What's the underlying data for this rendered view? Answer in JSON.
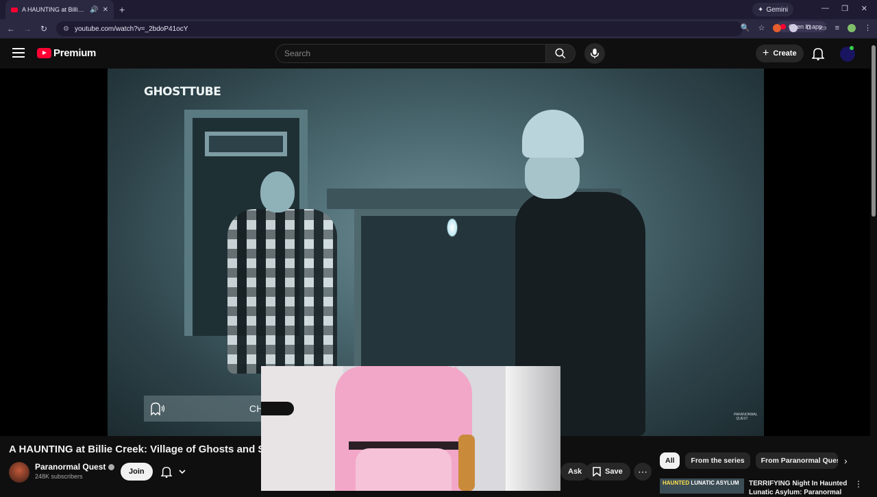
{
  "browser": {
    "tab_title": "A HAUNTING at Billie Creek",
    "url": "youtube.com/watch?v=_2bdoP41ocY",
    "gemini_label": "Gemini",
    "open_in_app_label": "Open in app"
  },
  "header": {
    "brand": "Premium",
    "search_placeholder": "Search",
    "create_label": "Create"
  },
  "player": {
    "overlay_logo": "GHOSTTUBE",
    "nametag": "CHRISTIAN",
    "watermark": "PARANORMAL QUEST"
  },
  "video": {
    "title": "A HAUNTING at Billie Creek: Village of Ghosts and Spirit",
    "channel_name": "Paranormal Quest",
    "subscribers": "248K subscribers",
    "join_label": "Join",
    "ask_label": "Ask",
    "save_label": "Save"
  },
  "chips": [
    "All",
    "From the series",
    "From Paranormal Quest"
  ],
  "recommended": {
    "thumb_text_1": "HAUNTED",
    "thumb_text_2": "LUNATIC ASYLUM",
    "title": "TERRIFYING Night In Haunted Lunatic Asylum: Paranormal"
  },
  "colors": {
    "brand_red": "#ff0033",
    "page_bg": "#0f0f0f",
    "chrome_bg": "#2b2842"
  }
}
